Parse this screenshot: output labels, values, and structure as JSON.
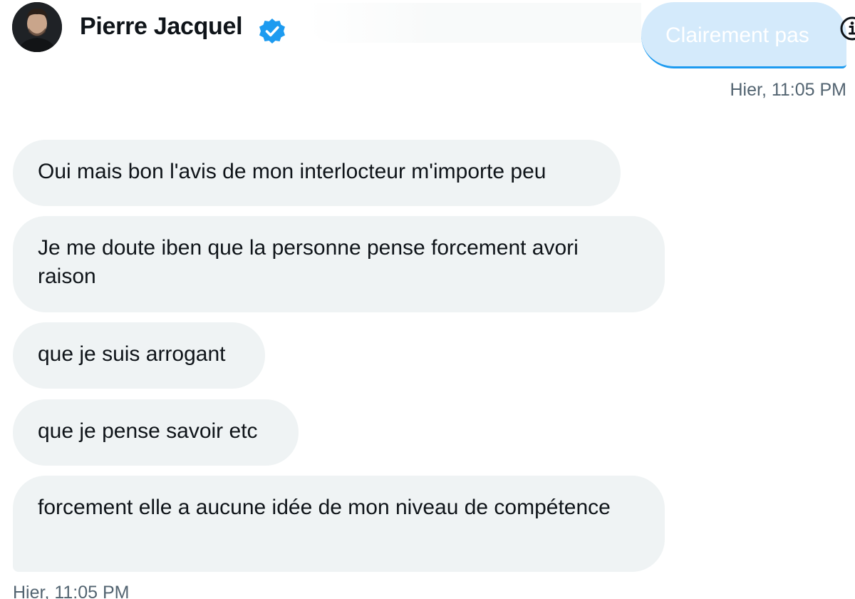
{
  "header": {
    "name": "Pierre Jacquel",
    "verified_icon": "verified-badge-icon",
    "avatar_icon": "avatar"
  },
  "sent": {
    "text": "Clairement pas",
    "time": "Hier, 11:05 PM",
    "info_icon": "info-icon"
  },
  "received": {
    "messages": [
      "Oui mais bon l'avis de mon interlocteur m'importe peu",
      "Je me doute iben que la personne pense forcement avori raison",
      "que je suis arrogant",
      "que je pense savoir etc",
      "forcement elle a aucune idée de mon niveau de compétence"
    ],
    "time": "Hier, 11:05 PM"
  },
  "colors": {
    "bubble_received": "#eff3f4",
    "bubble_sent": "#d4eafb",
    "accent": "#1d9bf0",
    "text_primary": "#0f1419",
    "text_secondary": "#536471"
  }
}
